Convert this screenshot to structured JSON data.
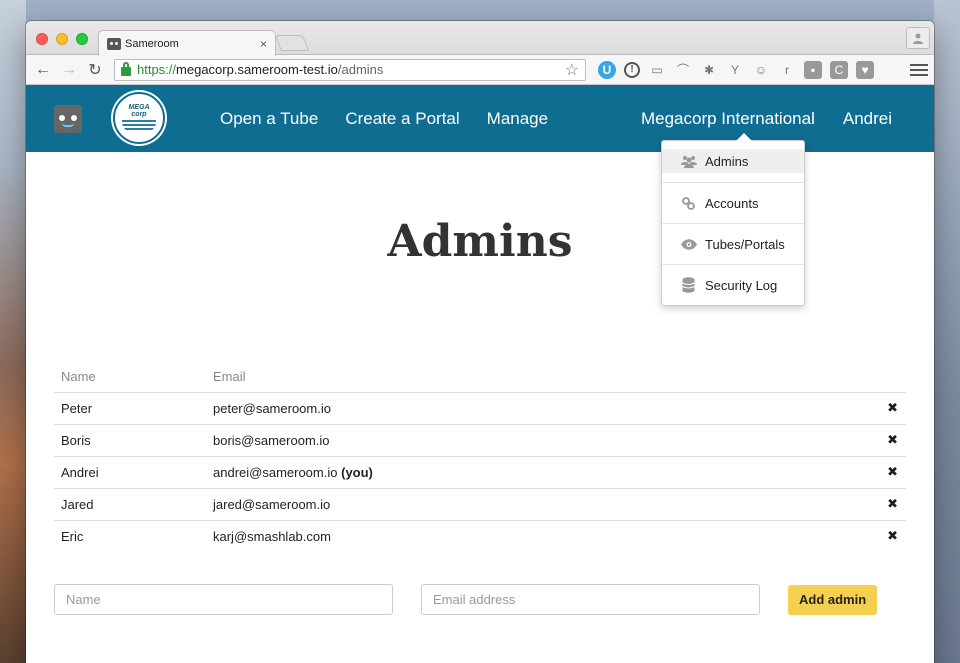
{
  "browser": {
    "tab_title": "Sameroom",
    "tab_close": "×",
    "profile_icon": "person-icon",
    "url_scheme": "https://",
    "url_host": "megacorp.sameroom-test.io",
    "url_path": "/admins",
    "star_glyph": "☆",
    "back_glyph": "←",
    "forward_glyph": "→",
    "reload_glyph": "↻",
    "extensions": [
      "U",
      "!",
      "▭",
      "⌒",
      "✱",
      "Y",
      "☺",
      "r",
      "▪",
      "C",
      "♥"
    ]
  },
  "app": {
    "colors": {
      "header": "#0f6d92",
      "accent_button": "#f5d04e"
    },
    "logo_text_top": "MEGA",
    "logo_text_bottom": "corp",
    "nav": {
      "open_tube": "Open a Tube",
      "create_portal": "Create a Portal",
      "manage": "Manage",
      "org": "Megacorp International",
      "user": "Andrei"
    },
    "dropdown": {
      "items": [
        {
          "label": "Admins",
          "icon": "users-icon"
        },
        {
          "label": "Accounts",
          "icon": "link-icon"
        },
        {
          "label": "Tubes/Portals",
          "icon": "eye-icon"
        },
        {
          "label": "Security Log",
          "icon": "database-icon"
        }
      ]
    }
  },
  "page": {
    "title": "Admins",
    "table": {
      "headers": {
        "name": "Name",
        "email": "Email"
      },
      "delete_glyph": "✖",
      "rows": [
        {
          "name": "Peter",
          "email": "peter@sameroom.io",
          "you": ""
        },
        {
          "name": "Boris",
          "email": "boris@sameroom.io",
          "you": ""
        },
        {
          "name": "Andrei",
          "email": "andrei@sameroom.io",
          "you": "(you)"
        },
        {
          "name": "Jared",
          "email": "jared@sameroom.io",
          "you": ""
        },
        {
          "name": "Eric",
          "email": "karj@smashlab.com",
          "you": ""
        }
      ]
    },
    "form": {
      "name_placeholder": "Name",
      "email_placeholder": "Email address",
      "add_button": "Add admin"
    }
  }
}
